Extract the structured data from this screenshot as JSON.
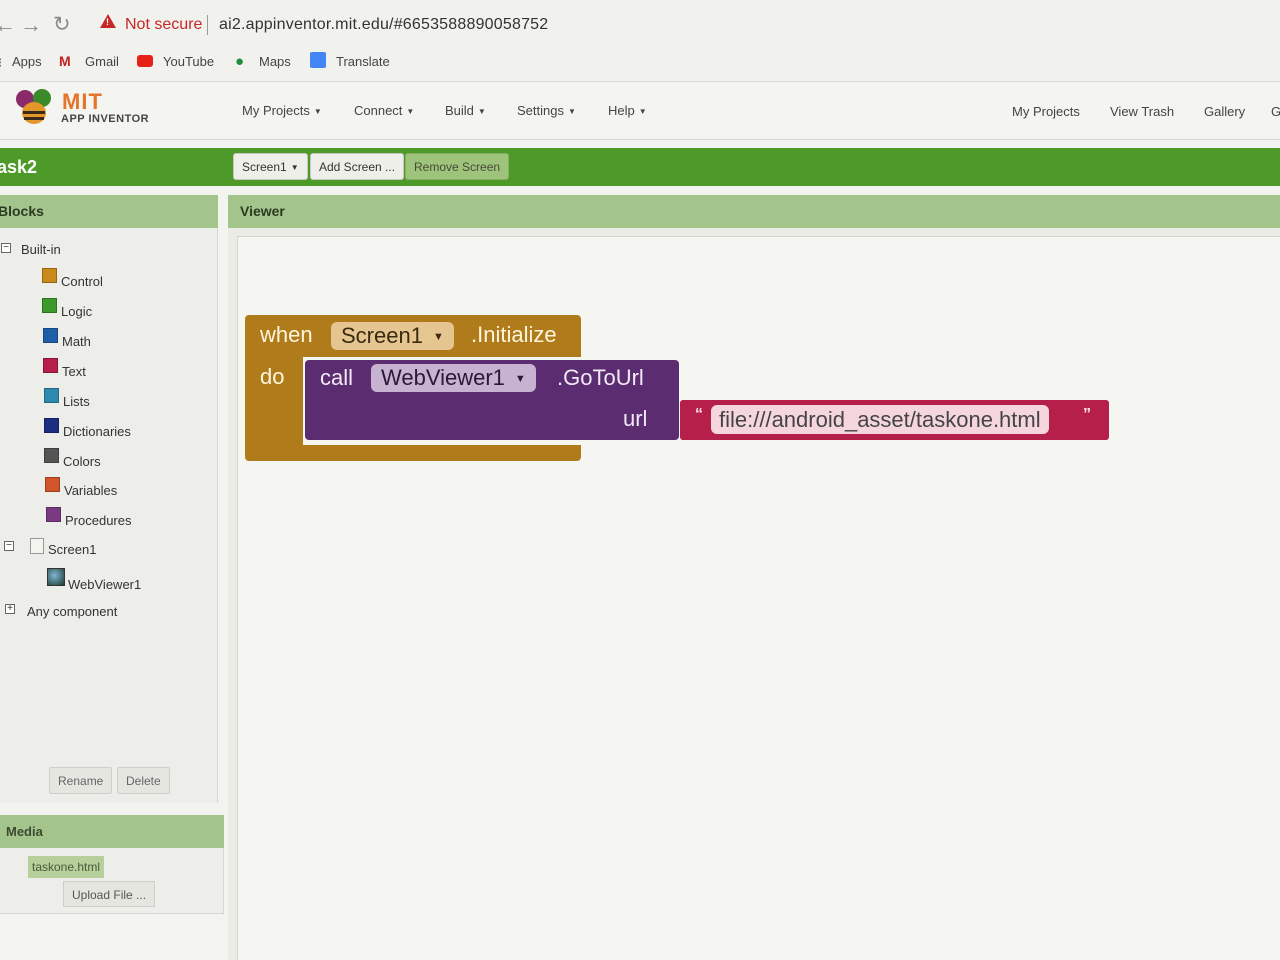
{
  "browser": {
    "security_label": "Not secure",
    "url": "ai2.appinventor.mit.edu/#6653588890058752",
    "bookmarks": [
      "Apps",
      "Gmail",
      "YouTube",
      "Maps",
      "Translate"
    ]
  },
  "header": {
    "logo_title": "MIT",
    "logo_subtitle": "APP INVENTOR",
    "menus": [
      "My Projects",
      "Connect",
      "Build",
      "Settings",
      "Help"
    ],
    "right_links": [
      "My Projects",
      "View Trash",
      "Gallery",
      "G"
    ]
  },
  "toolbar": {
    "project_name": "ask2",
    "screen_select": "Screen1",
    "add_screen": "Add Screen ...",
    "remove_screen": "Remove Screen"
  },
  "blocks_panel": {
    "title": "Blocks",
    "builtin_label": "Built-in",
    "builtin_items": [
      {
        "label": "Control",
        "color": "#c88a1a"
      },
      {
        "label": "Logic",
        "color": "#3c9a2a"
      },
      {
        "label": "Math",
        "color": "#1f5fa8"
      },
      {
        "label": "Text",
        "color": "#b51f4a"
      },
      {
        "label": "Lists",
        "color": "#2c8ab0"
      },
      {
        "label": "Dictionaries",
        "color": "#1d2d80"
      },
      {
        "label": "Colors",
        "color": "#555555"
      },
      {
        "label": "Variables",
        "color": "#d2552a"
      },
      {
        "label": "Procedures",
        "color": "#7a3a82"
      }
    ],
    "screen_label": "Screen1",
    "component_label": "WebViewer1",
    "any_component_label": "Any component",
    "rename_button": "Rename",
    "delete_button": "Delete"
  },
  "media_panel": {
    "title": "Media",
    "file": "taskone.html",
    "upload_button": "Upload File ..."
  },
  "viewer": {
    "title": "Viewer",
    "event_block": {
      "when_label": "when",
      "component": "Screen1",
      "event": ".Initialize",
      "do_label": "do"
    },
    "call_block": {
      "call_label": "call",
      "component": "WebViewer1",
      "method": ".GoToUrl",
      "arg_label": "url"
    },
    "text_block": {
      "value": "file:///android_asset/taskone.html",
      "open_quote": "“",
      "close_quote": "”"
    },
    "colors": {
      "event_block": "#b07c1b",
      "call_block": "#5b2c6f",
      "text_block": "#b51f4a"
    }
  }
}
